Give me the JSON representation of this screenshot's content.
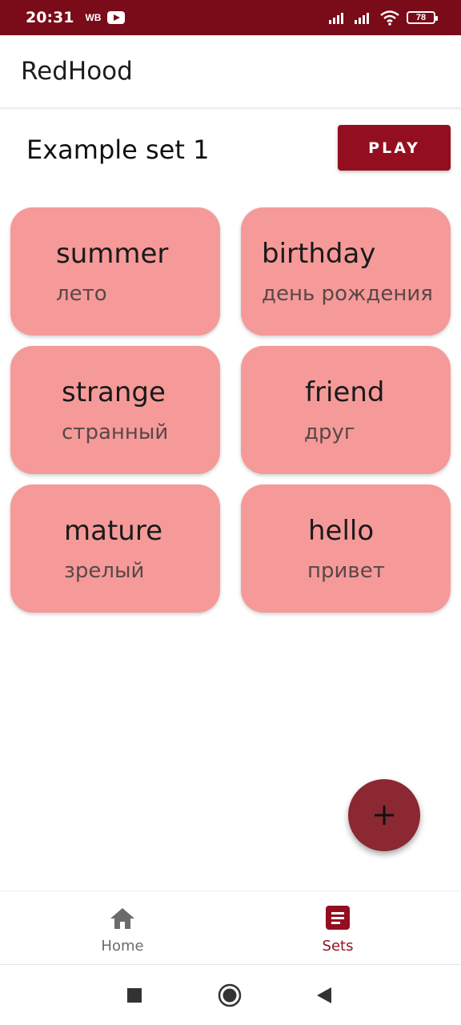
{
  "status_bar": {
    "time": "20:31",
    "app_label": "WB",
    "battery": "78"
  },
  "app_bar": {
    "title": "RedHood"
  },
  "set": {
    "title": "Example set 1",
    "play_label": "PLAY"
  },
  "cards": [
    {
      "word": "summer",
      "translation": "лето"
    },
    {
      "word": "birthday",
      "translation": "день рождения"
    },
    {
      "word": "strange",
      "translation": "странный"
    },
    {
      "word": "friend",
      "translation": "друг"
    },
    {
      "word": "mature",
      "translation": "зрелый"
    },
    {
      "word": "hello",
      "translation": "привет"
    }
  ],
  "fab": {
    "icon": "plus-icon"
  },
  "bottom_nav": {
    "items": [
      {
        "label": "Home",
        "icon": "home-icon",
        "active": false
      },
      {
        "label": "Sets",
        "icon": "list-icon",
        "active": true
      }
    ]
  },
  "colors": {
    "status_bar": "#7a0b19",
    "accent": "#930f1f",
    "card": "#f59a99",
    "fab": "#8b2832",
    "nav_inactive": "#6b6b6b",
    "nav_active": "#930f1f"
  }
}
